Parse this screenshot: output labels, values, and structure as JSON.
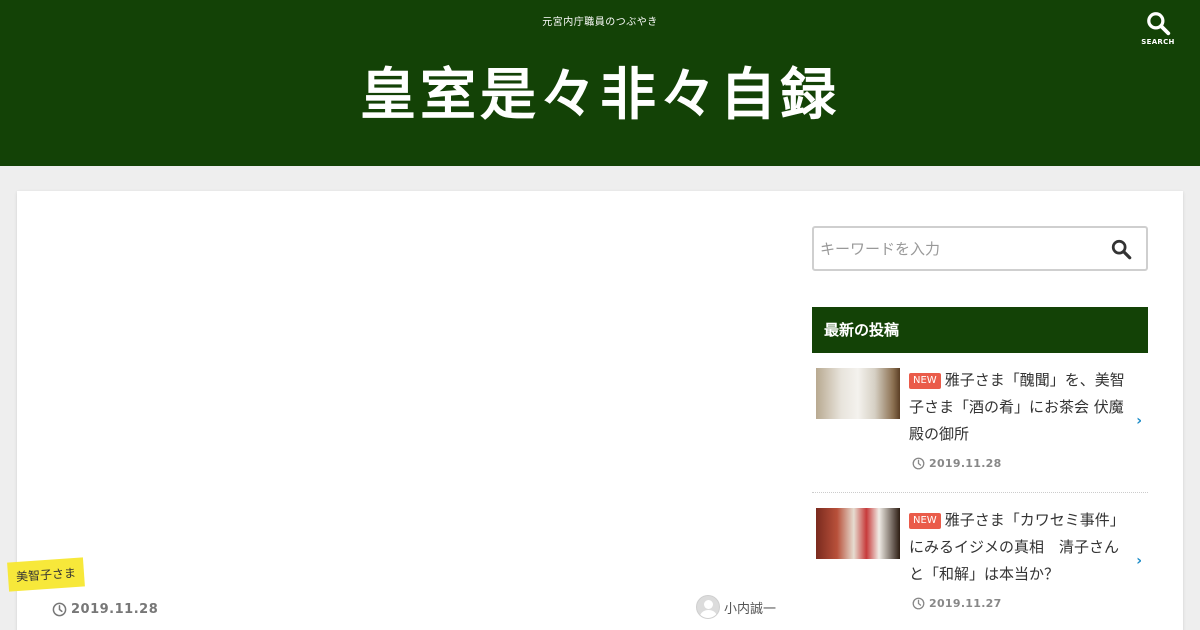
{
  "colors": {
    "header_bg": "#134206",
    "accent_badge": "#ea5b4a",
    "tag_bg": "#f7e83a",
    "chevron": "#1a8bc7"
  },
  "header": {
    "tagline": "元宮内庁職員のつぶやき",
    "site_title": "皇室是々非々自録",
    "search_label": "SEARCH",
    "search_icon": "search-icon"
  },
  "article": {
    "category": "美智子さま",
    "date": "2019.11.28",
    "author": "小内誠一",
    "date_icon": "clock-icon",
    "author_icon": "avatar-icon"
  },
  "sidebar": {
    "search_placeholder": "キーワードを入力",
    "widget_title": "最新の投稿",
    "posts": [
      {
        "badge": "NEW",
        "title": "雅子さま「醜聞」を、美智子さま「酒の肴」にお茶会 伏魔殿の御所",
        "date": "2019.11.28"
      },
      {
        "badge": "NEW",
        "title": "雅子さま「カワセミ事件」にみるイジメの真相　清子さんと「和解」は本当か？",
        "date": "2019.11.27"
      }
    ]
  }
}
